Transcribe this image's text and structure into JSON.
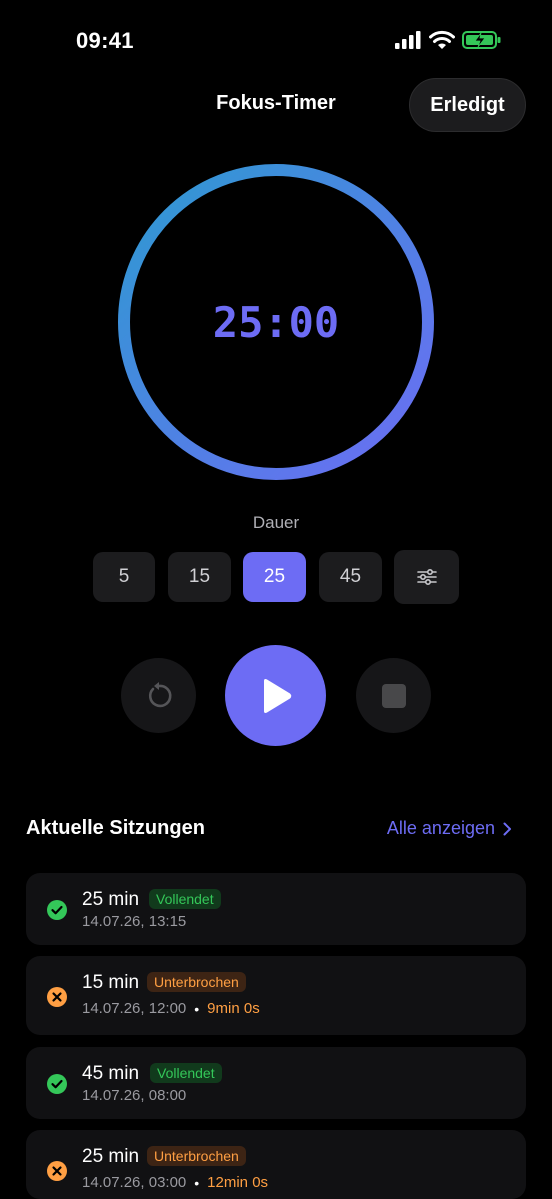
{
  "status_bar": {
    "time": "09:41"
  },
  "header": {
    "title": "Fokus-Timer",
    "done_label": "Erledigt"
  },
  "timer": {
    "display": "25:00",
    "progress": 1.0,
    "gradient_colors": [
      "#2d9ad1",
      "#6d6cf4"
    ]
  },
  "duration": {
    "label": "Dauer",
    "presets": [
      "5",
      "15",
      "25",
      "45"
    ],
    "selected": "25",
    "settings_icon": "sliders-icon"
  },
  "controls": {
    "reset_icon": "reset-icon",
    "play_icon": "play-icon",
    "stop_icon": "stop-icon"
  },
  "sessions": {
    "title": "Aktuelle Sitzungen",
    "show_all_label": "Alle anzeigen",
    "items": [
      {
        "title": "25 min",
        "status": "Vollendet",
        "kind": "done",
        "date": "14.07.26, 13:15",
        "elapsed": ""
      },
      {
        "title": "15 min",
        "status": "Unterbrochen",
        "kind": "interrupt",
        "date": "14.07.26, 12:00",
        "elapsed": "9min 0s"
      },
      {
        "title": "45 min",
        "status": "Vollendet",
        "kind": "done",
        "date": "14.07.26, 08:00",
        "elapsed": ""
      },
      {
        "title": "25 min",
        "status": "Unterbrochen",
        "kind": "interrupt",
        "date": "14.07.26, 03:00",
        "elapsed": "12min 0s"
      }
    ]
  },
  "colors": {
    "accent": "#6d6cf4",
    "success": "#34c759",
    "warning": "#ff9f43",
    "background": "#000000",
    "card": "#111113"
  }
}
